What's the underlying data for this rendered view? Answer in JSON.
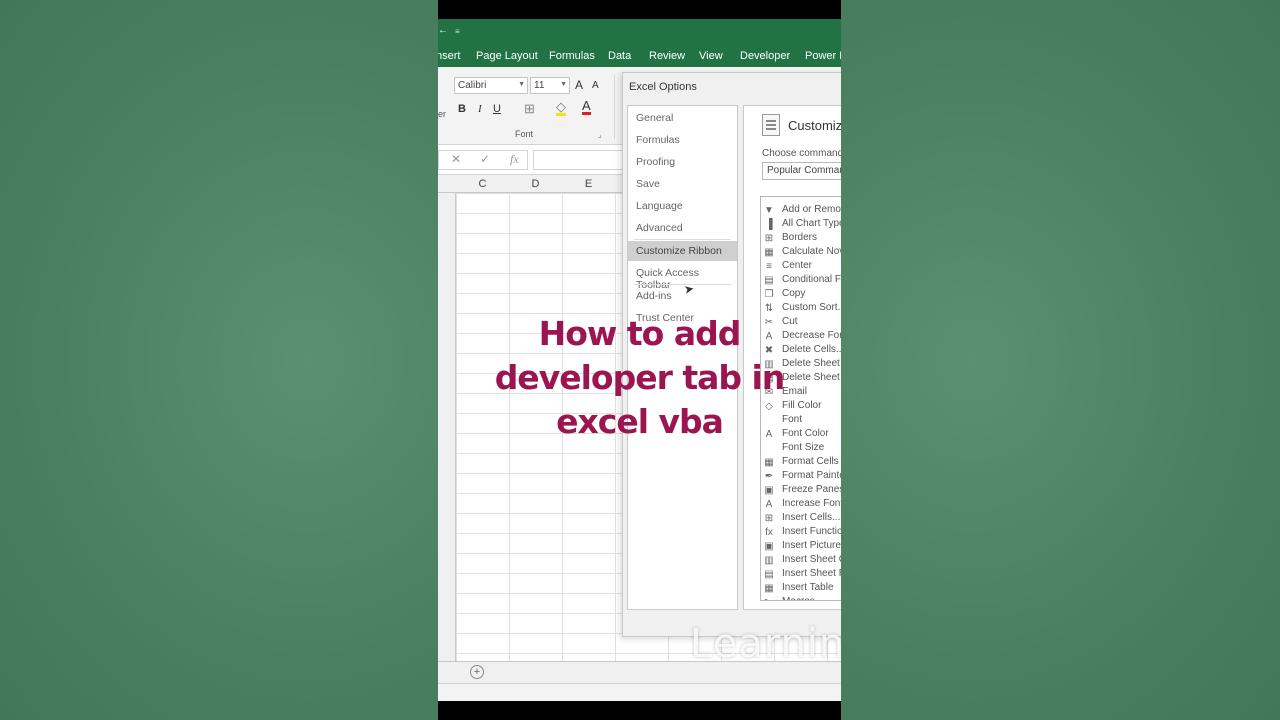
{
  "qat": {
    "symbol": "←",
    "dropdown": "≡"
  },
  "ribbon_tabs": [
    "nsert",
    "Page Layout",
    "Formulas",
    "Data",
    "Review",
    "View",
    "Developer",
    "Power Pi"
  ],
  "ribbon": {
    "left_fragment": "er",
    "font_name": "Calibri",
    "font_size": "11",
    "grow": "A",
    "shrink": "A",
    "bold": "B",
    "italic": "I",
    "underline": "U",
    "font_group_label": "Font"
  },
  "formula_bar": {
    "cancel": "✕",
    "enter": "✓",
    "fx": "fx"
  },
  "columns": [
    "C",
    "D",
    "E"
  ],
  "sheet_add": "+",
  "dialog": {
    "title": "Excel Options",
    "nav": [
      "General",
      "Formulas",
      "Proofing",
      "Save",
      "Language",
      "Advanced",
      "Customize Ribbon",
      "Quick Access Toolbar",
      "Add-ins",
      "Trust Center"
    ],
    "selected_nav": "Customize Ribbon",
    "main_title": "Customize",
    "choose_label": "Choose commands",
    "choose_value": "Popular Command",
    "commands": [
      {
        "icon": "filter-icon",
        "glyph": "▼",
        "label": "Add or Remo"
      },
      {
        "icon": "chart-icon",
        "glyph": "▐",
        "label": "All Chart Type"
      },
      {
        "icon": "borders-icon",
        "glyph": "⊞",
        "label": "Borders"
      },
      {
        "icon": "calculator-icon",
        "glyph": "▦",
        "label": "Calculate Nov"
      },
      {
        "icon": "center-icon",
        "glyph": "≡",
        "label": "Center"
      },
      {
        "icon": "conditional-format-icon",
        "glyph": "▤",
        "label": "Conditional Fo"
      },
      {
        "icon": "copy-icon",
        "glyph": "❐",
        "label": "Copy"
      },
      {
        "icon": "custom-sort-icon",
        "glyph": "⇅",
        "label": "Custom Sort..."
      },
      {
        "icon": "cut-icon",
        "glyph": "✂",
        "label": "Cut"
      },
      {
        "icon": "decrease-font-icon",
        "glyph": "A",
        "label": "Decrease Fon"
      },
      {
        "icon": "delete-cells-icon",
        "glyph": "✖",
        "label": "Delete Cells..."
      },
      {
        "icon": "delete-sheet-columns-icon",
        "glyph": "▥",
        "label": "Delete Sheet"
      },
      {
        "icon": "delete-sheet-rows-icon",
        "glyph": "▤",
        "label": "Delete Sheet"
      },
      {
        "icon": "email-icon",
        "glyph": "✉",
        "label": "Email"
      },
      {
        "icon": "fill-color-icon",
        "glyph": "◇",
        "label": "Fill Color"
      },
      {
        "icon": "",
        "glyph": "",
        "label": "Font"
      },
      {
        "icon": "font-color-icon",
        "glyph": "A",
        "label": "Font Color"
      },
      {
        "icon": "",
        "glyph": "",
        "label": "Font Size"
      },
      {
        "icon": "format-cells-icon",
        "glyph": "▦",
        "label": "Format Cells"
      },
      {
        "icon": "format-painter-icon",
        "glyph": "✒",
        "label": "Format Painte"
      },
      {
        "icon": "freeze-panes-icon",
        "glyph": "▣",
        "label": "Freeze Panes"
      },
      {
        "icon": "increase-font-icon",
        "glyph": "A",
        "label": "Increase Font"
      },
      {
        "icon": "insert-cells-icon",
        "glyph": "⊞",
        "label": "Insert Cells..."
      },
      {
        "icon": "insert-function-icon",
        "glyph": "fx",
        "label": "Insert Functio"
      },
      {
        "icon": "insert-picture-icon",
        "glyph": "▣",
        "label": "Insert Picture"
      },
      {
        "icon": "insert-sheet-columns-icon",
        "glyph": "▥",
        "label": "Insert Sheet C"
      },
      {
        "icon": "insert-sheet-rows-icon",
        "glyph": "▤",
        "label": "Insert Sheet R"
      },
      {
        "icon": "insert-table-icon",
        "glyph": "▦",
        "label": "Insert Table"
      },
      {
        "icon": "macros-icon",
        "glyph": "▶",
        "label": "Macros"
      }
    ]
  },
  "caption": {
    "line1": "How to add",
    "line2": "developer tab in",
    "line3": "excel vba"
  },
  "watermark": "Learnin",
  "colors": {
    "excel_green": "#217346",
    "caption": "#9b1550",
    "background": "#4c8563"
  }
}
